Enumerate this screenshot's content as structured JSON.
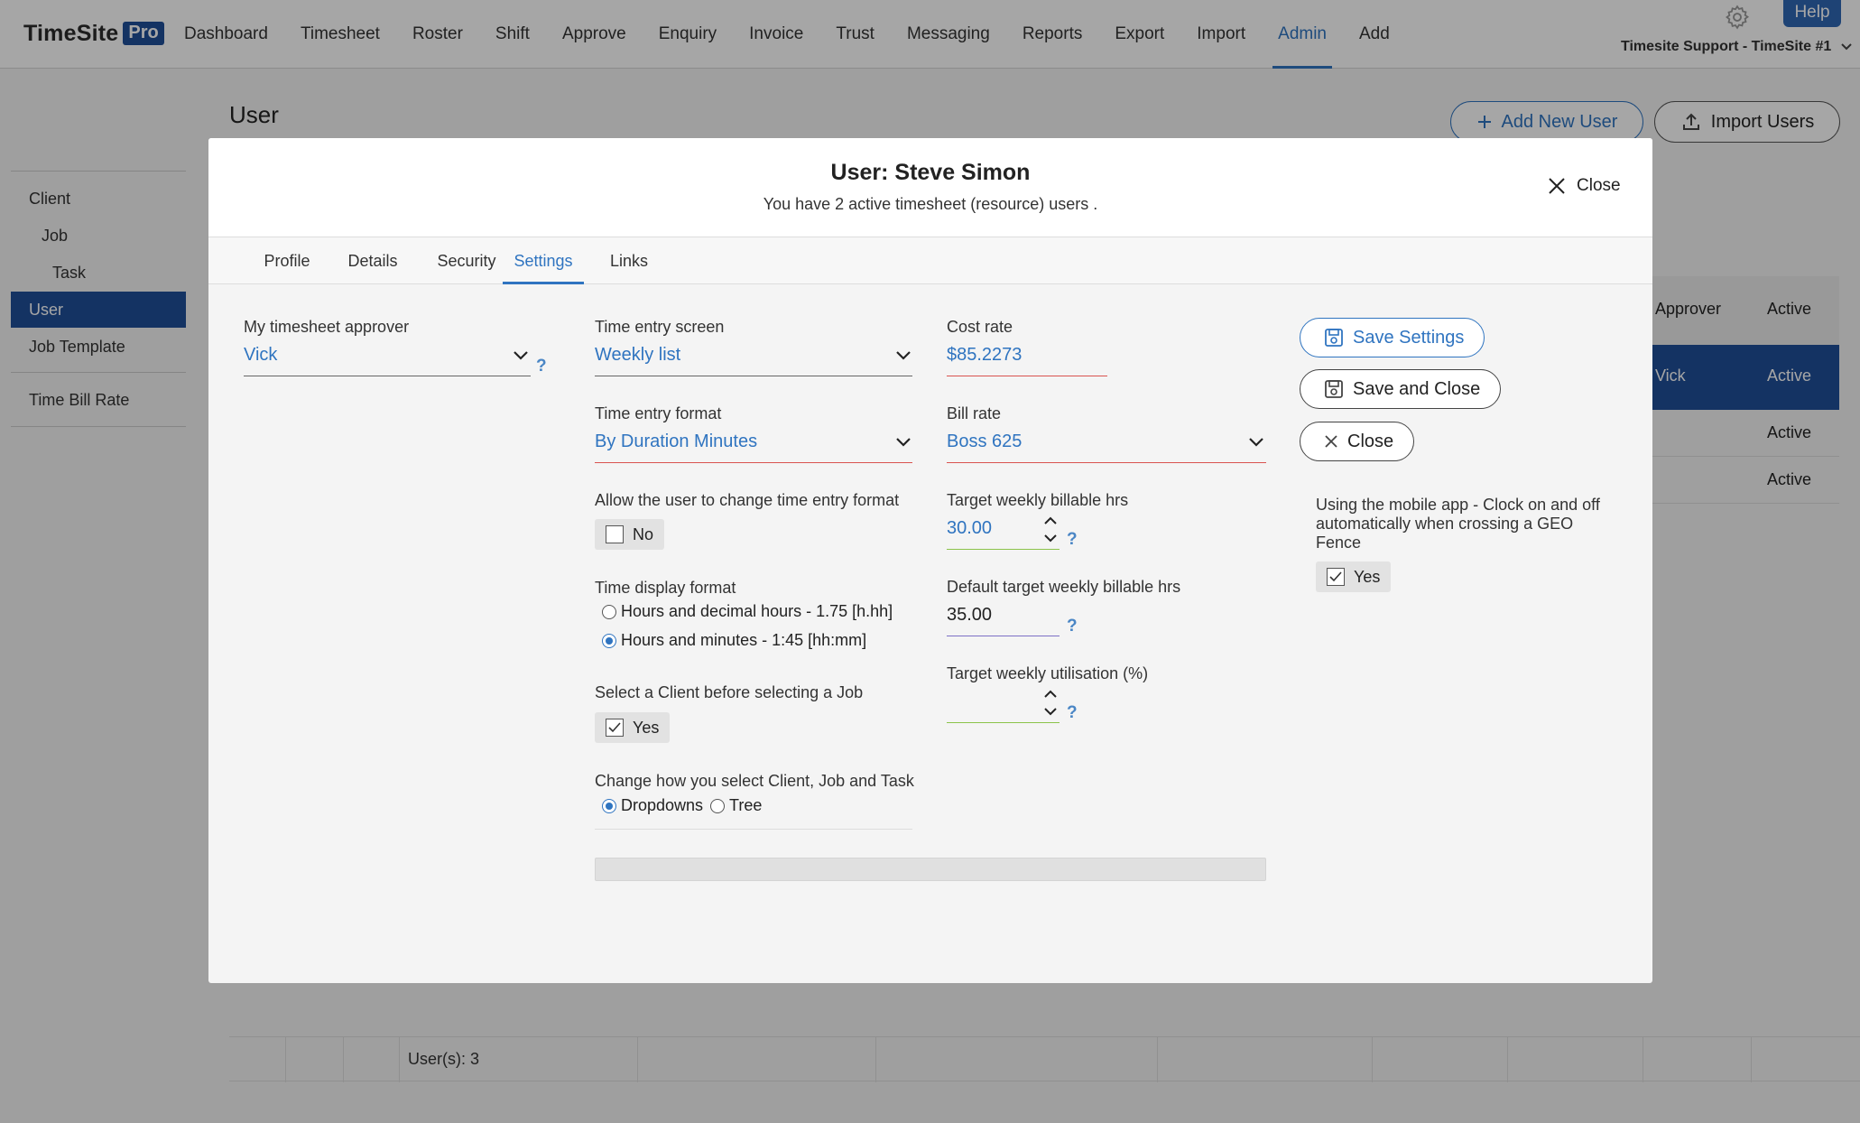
{
  "app": {
    "logo_text": "TimeSite",
    "logo_badge": "Pro",
    "nav": [
      "Dashboard",
      "Timesheet",
      "Roster",
      "Shift",
      "Approve",
      "Enquiry",
      "Invoice",
      "Trust",
      "Messaging",
      "Reports",
      "Export",
      "Import",
      "Admin",
      "Add"
    ],
    "active_nav": "Admin",
    "help_label": "Help",
    "account_label": "Timesite Support - TimeSite #1",
    "accent_color": "#2f74c0",
    "brand_color": "#1f4f99"
  },
  "background": {
    "page_title": "User",
    "sidebar": [
      "Client",
      "Job",
      "Task",
      "User",
      "Job Template",
      "Time Bill Rate"
    ],
    "sidebar_active": "User",
    "add_user_label": "Add New User",
    "import_users_label": "Import Users",
    "table_headers": [
      "Approver",
      "Active"
    ],
    "table_rows": [
      {
        "approver": "Vick",
        "active": "Active"
      },
      {
        "approver": "",
        "active": "Active"
      },
      {
        "approver": "",
        "active": "Active"
      }
    ],
    "footer_count": "User(s): 3"
  },
  "modal": {
    "title": "User: Steve Simon",
    "subtitle": "You have 2 active timesheet (resource) users .",
    "close_label": "Close",
    "tabs": [
      "Profile",
      "Details",
      "Security",
      "Settings",
      "Links"
    ],
    "active_tab": "Settings",
    "help_mark": "?",
    "approver": {
      "label": "My timesheet approver",
      "value": "Vick"
    },
    "time_entry_screen": {
      "label": "Time entry screen",
      "value": "Weekly list"
    },
    "time_entry_format": {
      "label": "Time entry format",
      "value": "By Duration Minutes"
    },
    "allow_change_format": {
      "label": "Allow the user to change time entry format",
      "value": "No",
      "checked": false
    },
    "time_display_format": {
      "label": "Time display format",
      "options": [
        "Hours and decimal hours - 1.75 [h.hh]",
        "Hours and minutes - 1:45 [hh:mm]"
      ],
      "selected": "Hours and minutes - 1:45 [hh:mm]"
    },
    "select_client_first": {
      "label": "Select a Client before selecting a Job",
      "value": "Yes",
      "checked": true
    },
    "selection_method": {
      "label": "Change how you select Client, Job and Task",
      "options": [
        "Dropdowns",
        "Tree"
      ],
      "selected": "Dropdowns"
    },
    "cost_rate": {
      "label": "Cost rate",
      "value": "$85.2273"
    },
    "bill_rate": {
      "label": "Bill rate",
      "value": "Boss 625"
    },
    "target_weekly_billable": {
      "label": "Target weekly billable hrs",
      "value": "30.00"
    },
    "default_target_weekly_billable": {
      "label": "Default target weekly billable hrs",
      "value": "35.00"
    },
    "target_weekly_utilisation": {
      "label": "Target weekly utilisation (%)",
      "value": ""
    },
    "save_settings_label": "Save Settings",
    "save_close_label": "Save and Close",
    "close_button_label": "Close",
    "geo_fence": {
      "label": "Using the mobile app - Clock on and off automatically when crossing a GEO Fence",
      "value": "Yes",
      "checked": true
    }
  }
}
